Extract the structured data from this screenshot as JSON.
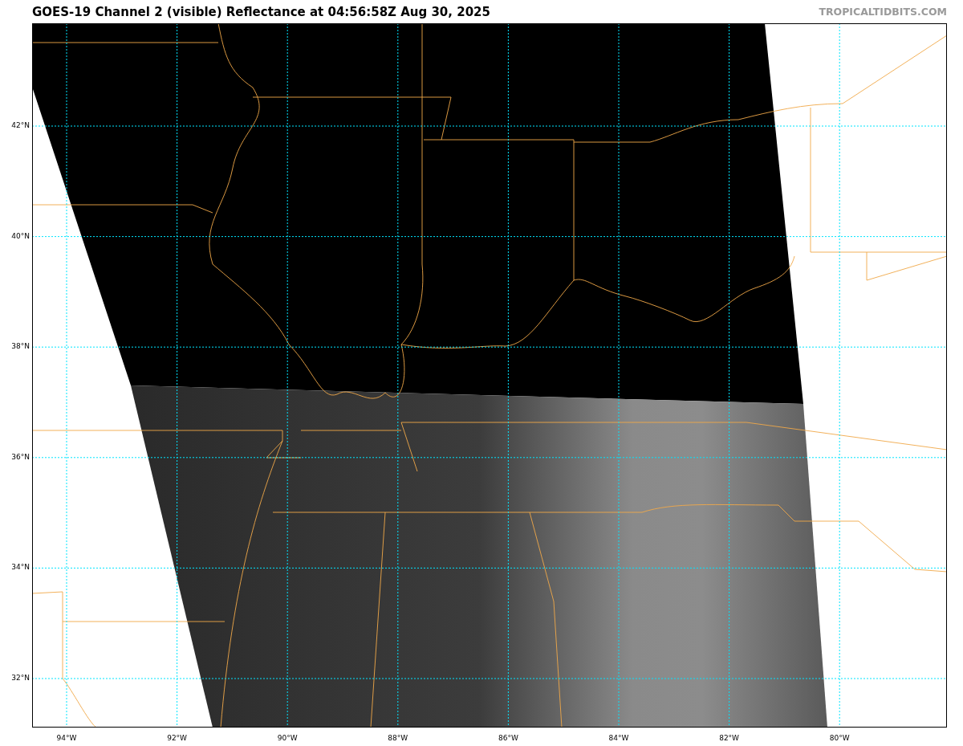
{
  "title": "GOES-19 Channel 2 (visible) Reflectance at 04:56:58Z Aug 30, 2025",
  "credit": "TROPICALTIDBITS.COM",
  "map": {
    "lat_labels": [
      "42°N",
      "40°N",
      "38°N",
      "36°N",
      "34°N",
      "32°N"
    ],
    "lon_labels": [
      "94°W",
      "92°W",
      "90°W",
      "88°W",
      "86°W",
      "84°W",
      "82°W",
      "80°W"
    ]
  }
}
